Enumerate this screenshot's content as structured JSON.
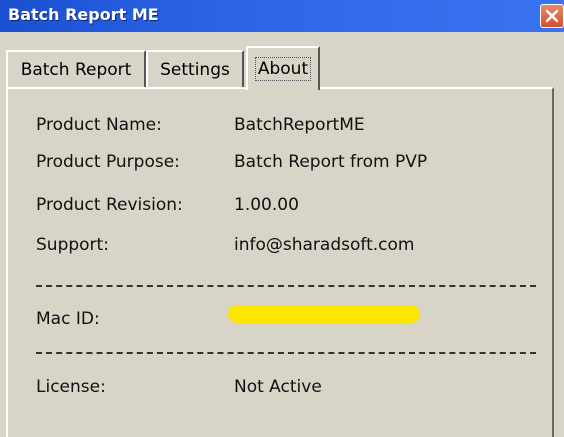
{
  "window": {
    "title": "Batch Report ME",
    "close_icon": "close-icon"
  },
  "tabs": [
    {
      "label": "Batch Report",
      "active": false
    },
    {
      "label": "Settings",
      "active": false
    },
    {
      "label": "About",
      "active": true
    }
  ],
  "about": {
    "product_name_label": "Product Name:",
    "product_name_value": "BatchReportME",
    "product_purpose_label": "Product Purpose:",
    "product_purpose_value": "Batch Report from PVP",
    "product_revision_label": "Product Revision:",
    "product_revision_value": "1.00.00",
    "support_label": "Support:",
    "support_value": "info@sharadsoft.com",
    "mac_id_label": "Mac ID:",
    "license_label": "License:",
    "license_value": "Not Active"
  },
  "colors": {
    "titlebar": "#2d64e6",
    "redaction": "#fce600",
    "close_button": "#d1502e"
  }
}
